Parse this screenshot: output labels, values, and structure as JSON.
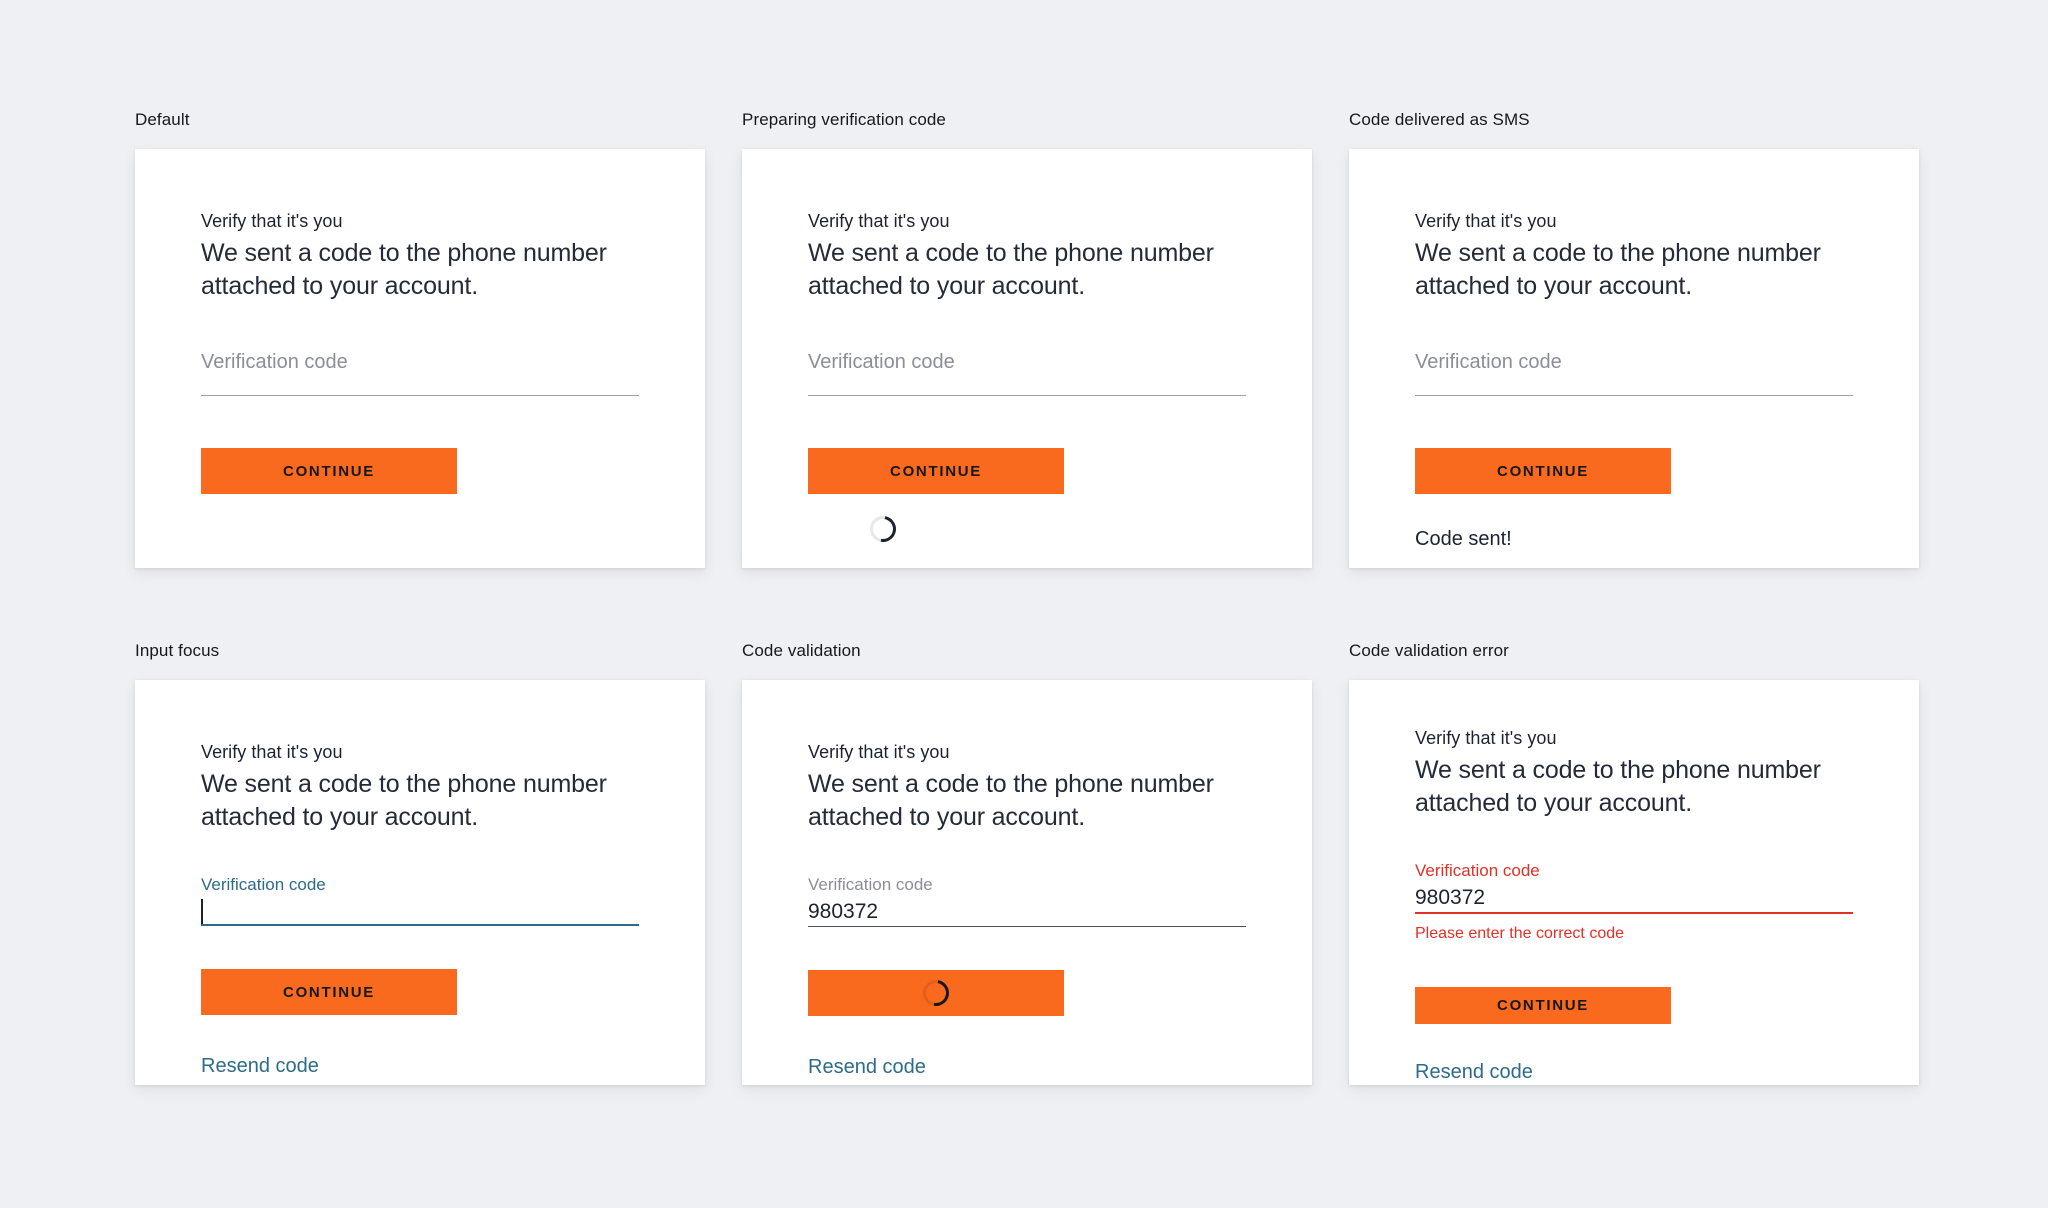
{
  "accent": {
    "orange": "#fa6a1e",
    "link_teal": "#2d6b88",
    "error_red": "#e03127",
    "canvas": "#eef0f3",
    "card": "#ffffff"
  },
  "copy": {
    "eyebrow": "Verify that it's you",
    "lede": "We sent a code to the phone number attached to your account.",
    "field_placeholder": "Verification code",
    "field_label": "Verification code",
    "continue_label": "CONTINUE",
    "resend_label": "Resend code",
    "code_sent": "Code sent!",
    "code_value": "980372",
    "error_message": "Please enter the correct code"
  },
  "sections": [
    {
      "id": "default",
      "label": "Default"
    },
    {
      "id": "preparing",
      "label": "Preparing verification code"
    },
    {
      "id": "delivered-sms",
      "label": "Code delivered as SMS"
    },
    {
      "id": "input-focus",
      "label": "Input focus"
    },
    {
      "id": "code-validation",
      "label": "Code validation"
    },
    {
      "id": "validation-error",
      "label": "Code validation error"
    }
  ]
}
